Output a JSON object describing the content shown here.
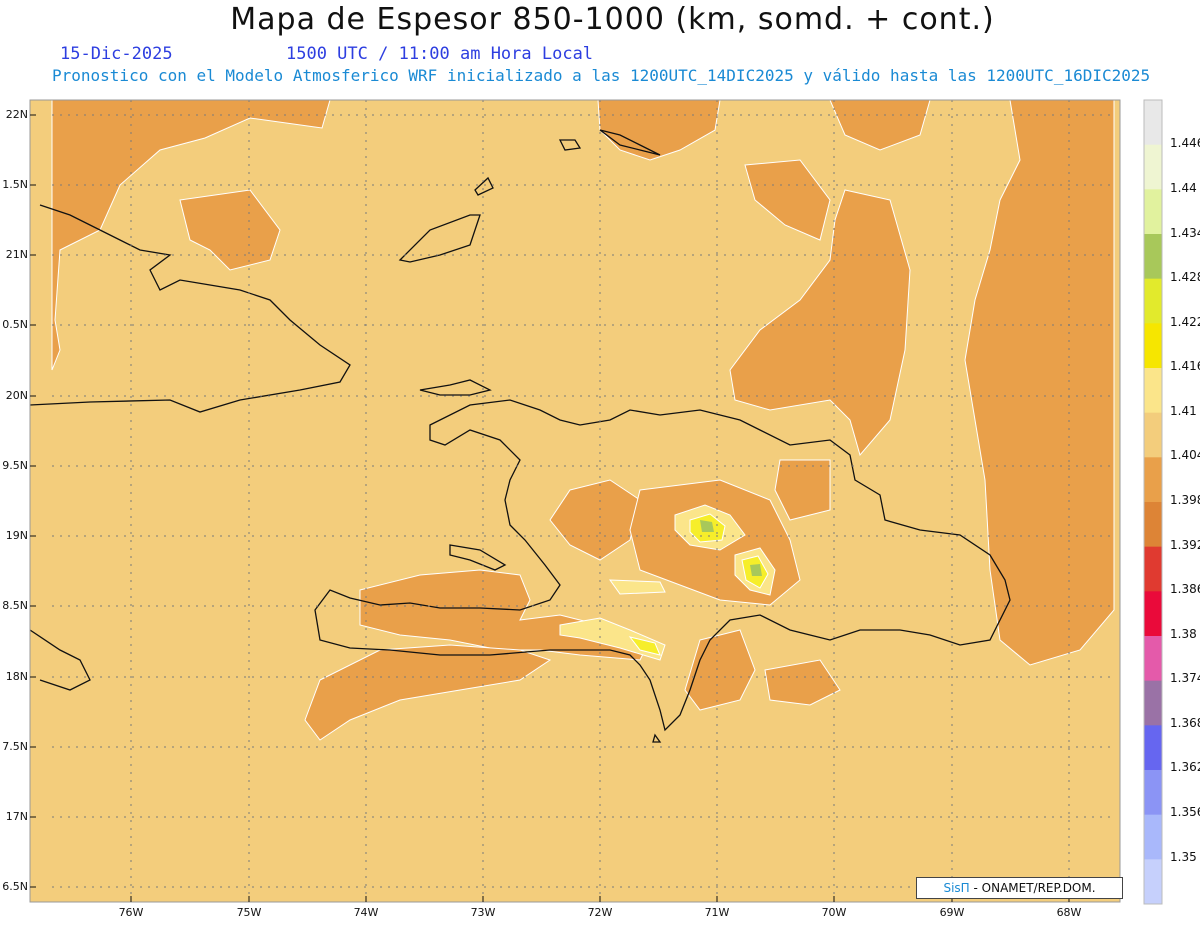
{
  "header": {
    "title": "Mapa de Espesor 850-1000 (km, somd. + cont.)",
    "date": "15-Dic-2025",
    "time": "1500 UTC / 11:00 am Hora Local",
    "subtitle": "Pronostico con el Modelo Atmosferico WRF inicializado a las 1200UTC_14DIC2025 y válido hasta las  1200UTC_16DIC2025"
  },
  "map": {
    "lat_labels": [
      "22N",
      "1.5N",
      "21N",
      "0.5N",
      "20N",
      "9.5N",
      "19N",
      "8.5N",
      "18N",
      "7.5N",
      "17N",
      "6.5N"
    ],
    "lon_labels": [
      "76W",
      "75W",
      "74W",
      "73W",
      "72W",
      "71W",
      "70W",
      "69W",
      "68W"
    ],
    "lat_range": [
      16.4,
      22.1
    ],
    "lon_range": [
      -76.7,
      -67.6
    ],
    "gridlines": "dotted",
    "fill_colors": {
      "base": "#f3cd7c",
      "low": "#e9a04a",
      "high_1": "#fbe58a",
      "high_2": "#f6ee2a",
      "high_3": "#a8c85a"
    }
  },
  "colorbar": {
    "levels": [
      "1.446",
      "1.44",
      "1.434",
      "1.428",
      "1.422",
      "1.416",
      "1.41",
      "1.404",
      "1.398",
      "1.392",
      "1.386",
      "1.38",
      "1.374",
      "1.368",
      "1.362",
      "1.356",
      "1.35"
    ],
    "colors": [
      "#e8e8e8",
      "#eff5d2",
      "#e1f29e",
      "#a8c85a",
      "#e2ea2c",
      "#f6e600",
      "#fbe58a",
      "#f3cd7c",
      "#e9a04a",
      "#dd8436",
      "#e03a30",
      "#ea0a3a",
      "#e45aaa",
      "#9a72a6",
      "#6666f0",
      "#8b94f5",
      "#a9b8fb",
      "#c6d0fc"
    ]
  },
  "credit": {
    "brand": "SisΠ",
    "text": " - ONAMET/REP.DOM."
  }
}
